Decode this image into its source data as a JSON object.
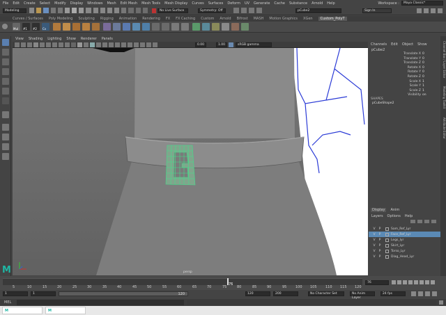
{
  "menubar": {
    "items": [
      "File",
      "Edit",
      "Create",
      "Select",
      "Modify",
      "Display",
      "Windows",
      "Mesh",
      "Edit Mesh",
      "Mesh Tools",
      "Mesh Display",
      "Curves",
      "Surfaces",
      "Deform",
      "UV",
      "Generate",
      "Cache",
      "Substance",
      "Arnold",
      "Help"
    ],
    "workspace_label": "Workspace :",
    "workspace_value": "Maya Classic*"
  },
  "status": {
    "mode": "Modeling",
    "live_surface": "No Live Surface",
    "symmetry": "Symmetry: Off",
    "object_name": "pCube2",
    "sign_in": "Sign In"
  },
  "shelf": {
    "tabs": [
      "Curves / Surfaces",
      "Poly Modeling",
      "Sculpting",
      "Rigging",
      "Animation",
      "Rendering",
      "FX",
      "FX Caching",
      "Custom",
      "Arnold",
      "Bifrost",
      "MASH",
      "Motion Graphics",
      "XGen",
      "Custom_PolyT"
    ],
    "active_tab": "Custom_PolyT",
    "icon_labels": [
      "Mul",
      "#1",
      "#2",
      "Cv"
    ]
  },
  "panel": {
    "menus": [
      "View",
      "Shading",
      "Lighting",
      "Show",
      "Renderer",
      "Panels"
    ],
    "num1": "0.00",
    "num2": "1.00",
    "colorspace": "sRGB gamma",
    "camera_label": "persp"
  },
  "channel_box": {
    "menus": [
      "Channels",
      "Edit",
      "Object",
      "Show"
    ],
    "object": "pCube2",
    "attributes": [
      {
        "name": "Translate X",
        "value": "0"
      },
      {
        "name": "Translate Y",
        "value": "0"
      },
      {
        "name": "Translate Z",
        "value": "0"
      },
      {
        "name": "Rotate X",
        "value": "0"
      },
      {
        "name": "Rotate Y",
        "value": "0"
      },
      {
        "name": "Rotate Z",
        "value": "0"
      },
      {
        "name": "Scale X",
        "value": "1"
      },
      {
        "name": "Scale Y",
        "value": "1"
      },
      {
        "name": "Scale Z",
        "value": "1"
      },
      {
        "name": "Visibility",
        "value": "on"
      }
    ],
    "shapes_header": "SHAPES",
    "shape_name": "pCubeShape2"
  },
  "side_tabs": [
    "Channel Box / Layer Editor",
    "Modeling Toolkit",
    "Attribute Editor"
  ],
  "layers": {
    "tabs": [
      "Display",
      "Anim"
    ],
    "menus": [
      "Layers",
      "Options",
      "Help"
    ],
    "rows": [
      {
        "v": "V",
        "p": "P",
        "name": "Sam_Ref_Lyr",
        "color": "#444444",
        "selected": false
      },
      {
        "v": "V",
        "p": "P",
        "name": "Face_Ref_Lyr",
        "color": "#5b8ab5",
        "selected": true
      },
      {
        "v": "V",
        "p": "P",
        "name": "Legs_lyr",
        "color": "#444444",
        "selected": false
      },
      {
        "v": "V",
        "p": "P",
        "name": "Skirt_Lyr",
        "color": "#444444",
        "selected": false
      },
      {
        "v": "V",
        "p": "P",
        "name": "Torso_Lyr",
        "color": "#444444",
        "selected": false
      },
      {
        "v": "V",
        "p": "P",
        "name": "Diag_Head_Lyr",
        "color": "#444444",
        "selected": false
      }
    ]
  },
  "time_slider": {
    "ticks": [
      "5",
      "10",
      "15",
      "20",
      "25",
      "30",
      "35",
      "40",
      "45",
      "50",
      "55",
      "60",
      "65",
      "70",
      "75",
      "80",
      "85",
      "90",
      "95",
      "100",
      "105",
      "110",
      "115",
      "120"
    ],
    "current_frame": "76",
    "current_frame_field": "76"
  },
  "range_slider": {
    "start": "1",
    "start2": "1",
    "range_value": "120",
    "end": "120",
    "end2": "200",
    "character_set": "No Character Set",
    "anim_layer": "No Anim Layer",
    "fps": "24 fps"
  },
  "command_line": {
    "label": "MEL"
  },
  "taskbar": {
    "items": [
      "M",
      "M"
    ]
  },
  "colors": {
    "accent_selection": "#5b8ab5",
    "wireframe_green": "#3fe08a",
    "maya_logo": "#1fb5a3"
  }
}
